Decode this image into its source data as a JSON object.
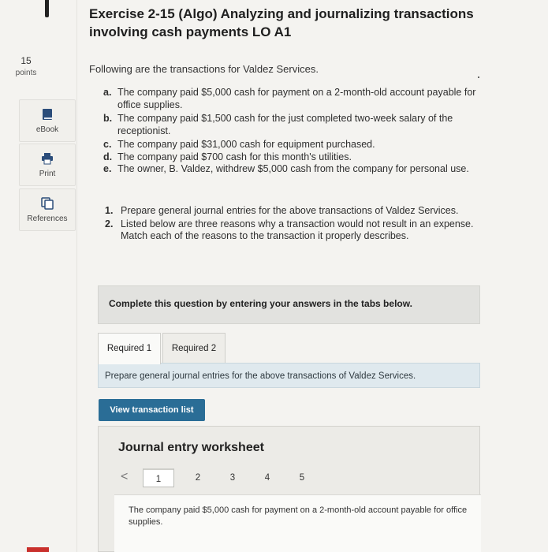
{
  "sidebar": {
    "points_value": "15",
    "points_label": "points",
    "tools": [
      {
        "label": "eBook",
        "icon": "book-icon"
      },
      {
        "label": "Print",
        "icon": "printer-icon"
      },
      {
        "label": "References",
        "icon": "references-icon"
      }
    ]
  },
  "header": {
    "title_line1": "Exercise 2-15 (Algo) Analyzing and journalizing transactions",
    "title_line2": "involving cash payments LO A1"
  },
  "intro": "Following are the transactions for Valdez Services.",
  "transactions": [
    {
      "letter": "a.",
      "text": "The company paid $5,000 cash for payment on a 2-month-old account payable for office supplies."
    },
    {
      "letter": "b.",
      "text": "The company paid $1,500 cash for the just completed two-week salary of the receptionist."
    },
    {
      "letter": "c.",
      "text": "The company paid $31,000 cash for equipment purchased."
    },
    {
      "letter": "d.",
      "text": "The company paid $700 cash for this month's utilities."
    },
    {
      "letter": "e.",
      "text": "The owner, B. Valdez, withdrew $5,000 cash from the company for personal use."
    }
  ],
  "instructions": [
    {
      "num": "1.",
      "text": "Prepare general journal entries for the above transactions of Valdez Services."
    },
    {
      "num": "2.",
      "text": "Listed below are three reasons why a transaction would not result in an expense. Match each of the reasons to the transaction it properly describes."
    }
  ],
  "complete_banner": "Complete this question by entering your answers in the tabs below.",
  "tabs": [
    {
      "label": "Required 1",
      "active": true
    },
    {
      "label": "Required 2",
      "active": false
    }
  ],
  "tab_prompt": "Prepare general journal entries for the above transactions of Valdez Services.",
  "view_button": "View transaction list",
  "worksheet": {
    "title": "Journal entry worksheet",
    "prev_symbol": "<",
    "pages": [
      "1",
      "2",
      "3",
      "4",
      "5"
    ],
    "active_page": "1",
    "description": "The company paid $5,000 cash for payment on a 2-month-old account payable for office supplies."
  },
  "colors": {
    "button_blue": "#2a6d96",
    "prompt_bar": "#dfe9ee",
    "banner_gray": "#e2e2df"
  }
}
